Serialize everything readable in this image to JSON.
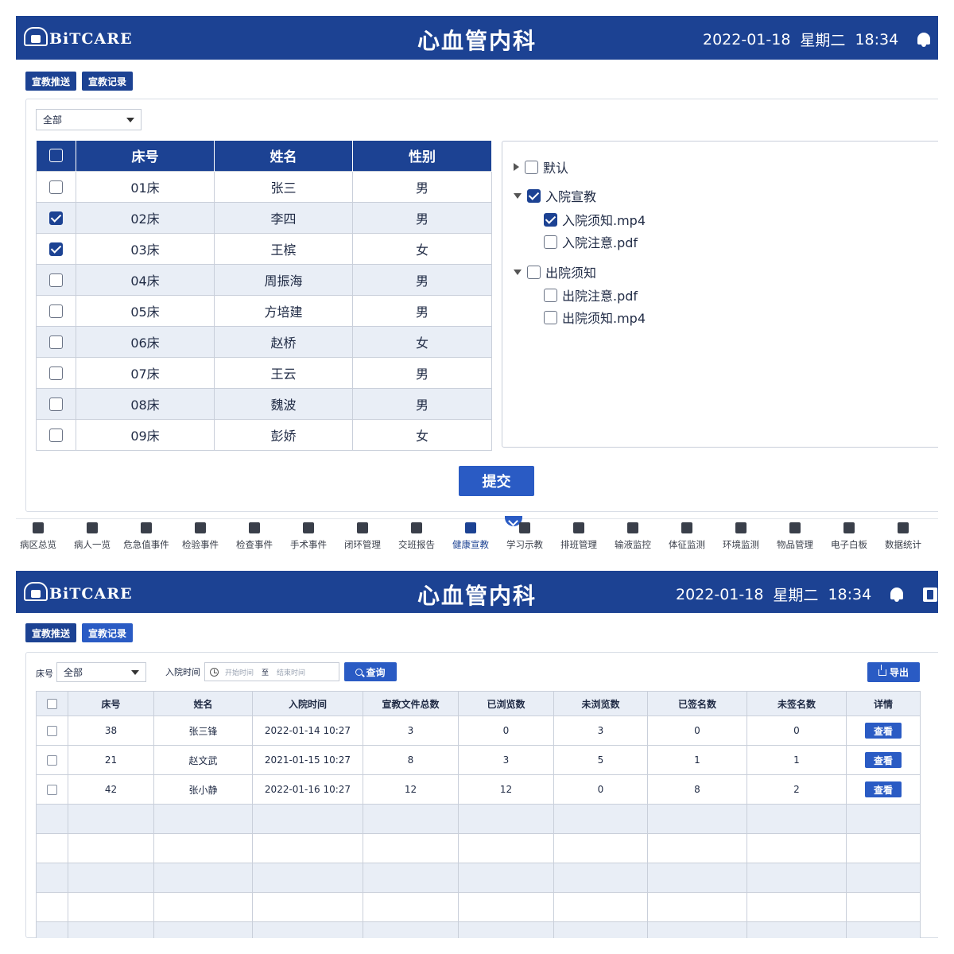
{
  "header": {
    "logo_text": "BiTCARE",
    "department": "心血管内科",
    "date": "2022-01-18",
    "weekday": "星期二",
    "time": "18:34"
  },
  "tabs": {
    "push": "宣教推送",
    "records": "宣教记录"
  },
  "push_screen": {
    "ward_filter": "全部",
    "patient_table": {
      "headers": [
        "床号",
        "姓名",
        "性别"
      ],
      "rows": [
        {
          "bed": "01床",
          "name": "张三",
          "gender": "男",
          "checked": false
        },
        {
          "bed": "02床",
          "name": "李四",
          "gender": "男",
          "checked": true
        },
        {
          "bed": "03床",
          "name": "王槟",
          "gender": "女",
          "checked": true
        },
        {
          "bed": "04床",
          "name": "周振海",
          "gender": "男",
          "checked": false
        },
        {
          "bed": "05床",
          "name": "方培建",
          "gender": "男",
          "checked": false
        },
        {
          "bed": "06床",
          "name": "赵桥",
          "gender": "女",
          "checked": false
        },
        {
          "bed": "07床",
          "name": "王云",
          "gender": "男",
          "checked": false
        },
        {
          "bed": "08床",
          "name": "魏波",
          "gender": "男",
          "checked": false
        },
        {
          "bed": "09床",
          "name": "彭娇",
          "gender": "女",
          "checked": false
        }
      ]
    },
    "material_tree": {
      "default": {
        "label": "默认",
        "checked": false,
        "expanded": false
      },
      "admission": {
        "label": "入院宣教",
        "checked": true,
        "expanded": true,
        "files": [
          {
            "label": "入院须知.mp4",
            "checked": true
          },
          {
            "label": "入院注意.pdf",
            "checked": false
          }
        ]
      },
      "discharge": {
        "label": "出院须知",
        "checked": false,
        "expanded": true,
        "files": [
          {
            "label": "出院注意.pdf",
            "checked": false
          },
          {
            "label": "出院须知.mp4",
            "checked": false
          }
        ]
      }
    },
    "submit_label": "提交"
  },
  "bottom_nav": {
    "active": "健康宣教",
    "items": [
      "病区总览",
      "病人一览",
      "危急值事件",
      "检验事件",
      "检查事件",
      "手术事件",
      "闭环管理",
      "交班报告",
      "健康宣教",
      "学习示教",
      "排班管理",
      "输液监控",
      "体征监测",
      "环境监测",
      "物品管理",
      "电子白板",
      "数据统计"
    ]
  },
  "records_screen": {
    "filters": {
      "bed_label": "床号",
      "bed_value": "全部",
      "admit_time_label": "入院时间",
      "start_placeholder": "开始时间",
      "range_sep": "至",
      "end_placeholder": "结束时间",
      "query_label": "查询",
      "export_label": "导出"
    },
    "table": {
      "headers": [
        "床号",
        "姓名",
        "入院时间",
        "宣教文件总数",
        "已浏览数",
        "未浏览数",
        "已签名数",
        "未签名数",
        "详情"
      ],
      "rows": [
        {
          "bed": "38",
          "name": "张三锋",
          "admit_time": "2022-01-14 10:27",
          "total": "3",
          "viewed": "0",
          "unviewed": "3",
          "signed": "0",
          "unsigned": "0",
          "detail": "查看"
        },
        {
          "bed": "21",
          "name": "赵文武",
          "admit_time": "2021-01-15 10:27",
          "total": "8",
          "viewed": "3",
          "unviewed": "5",
          "signed": "1",
          "unsigned": "1",
          "detail": "查看"
        },
        {
          "bed": "42",
          "name": "张小静",
          "admit_time": "2022-01-16 10:27",
          "total": "12",
          "viewed": "12",
          "unviewed": "0",
          "signed": "8",
          "unsigned": "2",
          "detail": "查看"
        }
      ]
    }
  },
  "colors": {
    "primary": "#1c4293",
    "button": "#2a5bc4",
    "row_alt": "#e9eef6",
    "border": "#c9cfda"
  }
}
